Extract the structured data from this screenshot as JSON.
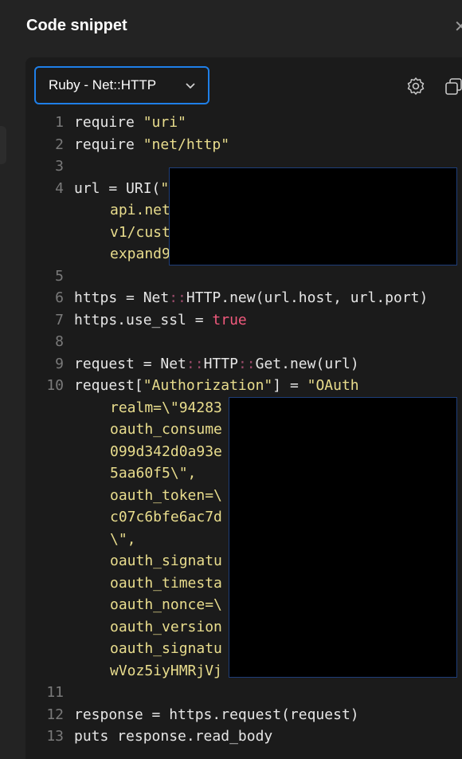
{
  "panel": {
    "title": "Code snippet"
  },
  "toolbar": {
    "language": "Ruby - Net::HTTP"
  },
  "icons": {
    "close": "close-icon",
    "settings": "gear-icon",
    "copy": "copy-icon",
    "dropdown": "chevron-down-icon"
  },
  "colors": {
    "accent": "#1f7fe8",
    "string": "#e9dd8d",
    "keyword": "#f25a7d"
  },
  "code": {
    "lines": {
      "n1": "1",
      "n2": "2",
      "n3": "3",
      "n4": "4",
      "n5": "5",
      "n6": "6",
      "n7": "7",
      "n8": "8",
      "n9": "9",
      "n10": "10",
      "n11": "11",
      "n12": "12",
      "n13": "13"
    },
    "l1": {
      "kw": "require ",
      "str": "\"uri\""
    },
    "l2": {
      "kw": "require ",
      "str": "\"net/http\""
    },
    "l4": {
      "a": "url = URI(",
      "b": "\"",
      "c1": "api.net",
      "c2": "v1/cust",
      "c3": "expand9"
    },
    "l6": {
      "a": "https = Net",
      "sep1": "::",
      "b": "HTTP.new(url.host, url.port)"
    },
    "l7": {
      "a": "https.use_ssl = ",
      "val": "true"
    },
    "l9": {
      "a": "request = Net",
      "sep1": "::",
      "b": "HTTP",
      "sep2": "::",
      "c": "Get.new(url)"
    },
    "l10": {
      "a": "request[",
      "key": "\"Authorization\"",
      "b": "] = ",
      "val": "\"OAuth",
      "c": [
        "realm=\\\"94283",
        "oauth_consume",
        "099d342d0a93e",
        "5aa60f5\\\",",
        "oauth_token=\\",
        "c07c6bfe6ac7d",
        "\\\",",
        "oauth_signatu",
        "oauth_timesta",
        "oauth_nonce=\\",
        "oauth_version",
        "oauth_signatu",
        "wVoz5iyHMRjVj"
      ]
    },
    "l12": "response = https.request(request)",
    "l13": "puts response.read_body"
  }
}
